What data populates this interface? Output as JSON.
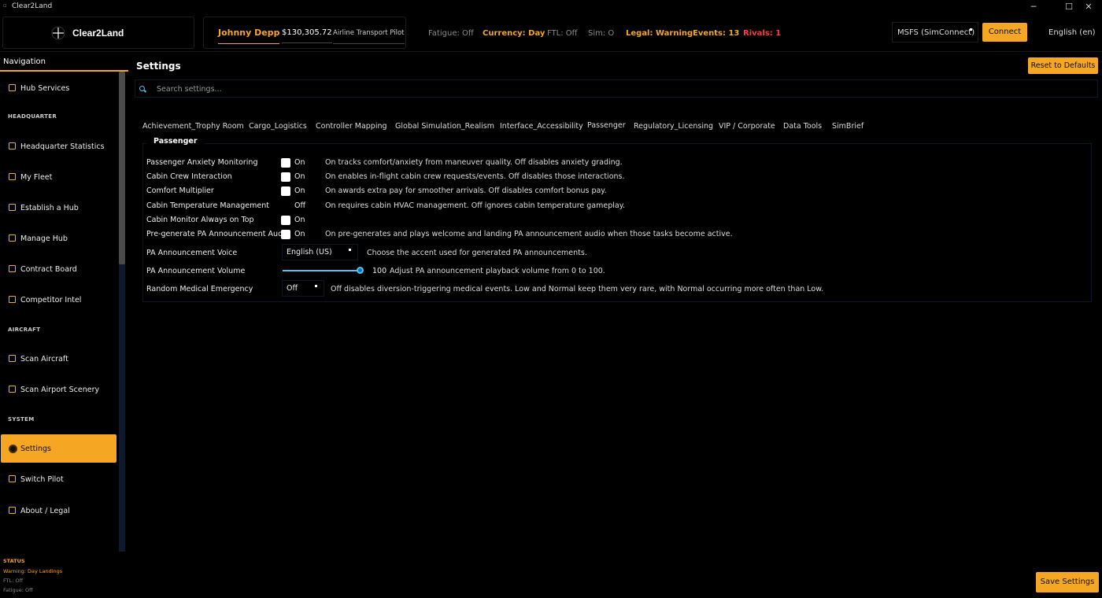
{
  "window": {
    "title": "Clear2Land",
    "minimize": "─",
    "maximize": "☐",
    "close": "✕"
  },
  "topbar": {
    "logo_text": "Clear2Land",
    "pilot_name": "Johnny Depp",
    "balance": "$130,305.72",
    "rank": "Airline Transport Pilot",
    "status": {
      "fatigue": "Fatigue: Off",
      "currency": "Currency: Day",
      "ftl": "FTL: Off",
      "sim": "Sim: O",
      "legal": "Legal: Warning",
      "events": "Events: 13",
      "rivals": "Rivals: 1"
    },
    "sim_select": "MSFS (SimConnect)",
    "connect_label": "Connect",
    "language": "English (en)"
  },
  "sidebar": {
    "header": "Navigation",
    "items": [
      {
        "label": "Hub Services",
        "icon": "building-icon"
      },
      {
        "label": "Headquarter Statistics",
        "icon": "grid-icon"
      },
      {
        "label": "My Fleet",
        "icon": "hangar-icon"
      },
      {
        "label": "Establish a Hub",
        "icon": "building-icon"
      },
      {
        "label": "Manage Hub",
        "icon": "building-icon"
      },
      {
        "label": "Contract Board",
        "icon": "clipboard-icon"
      },
      {
        "label": "Competitor Intel",
        "icon": "grid-icon"
      },
      {
        "label": "Scan Aircraft",
        "icon": "magnifier-icon"
      },
      {
        "label": "Scan Airport Scenery",
        "icon": "map-icon"
      },
      {
        "label": "Settings",
        "icon": "gear-icon"
      },
      {
        "label": "Switch Pilot",
        "icon": "swap-icon"
      },
      {
        "label": "About / Legal",
        "icon": "info-icon"
      }
    ],
    "sections": [
      "HEADQUARTER",
      "AIRCRAFT",
      "SYSTEM"
    ],
    "status": {
      "heading": "STATUS",
      "warning": "Warning: Day Landings",
      "ftl": "FTL: Off",
      "fatigue": "Fatigue: Off"
    }
  },
  "main": {
    "title": "Settings",
    "reset_label": "Reset to Defaults",
    "search_placeholder": "Search settings...",
    "tabs": [
      "Achievement_Trophy Room",
      "Cargo_Logistics",
      "Controller Mapping",
      "Global Simulation_Realism",
      "Interface_Accessibility",
      "Passenger",
      "Regulatory_Licensing",
      "VIP / Corporate",
      "Data Tools",
      "SimBrief"
    ],
    "active_tab": "Passenger",
    "group_title": "Passenger",
    "settings": [
      {
        "label": "Passenger Anxiety Monitoring",
        "checked": true,
        "state": "On",
        "desc": "On tracks comfort/anxiety from maneuver quality. Off disables anxiety grading."
      },
      {
        "label": "Cabin Crew Interaction",
        "checked": true,
        "state": "On",
        "desc": "On enables in-flight cabin crew requests/events. Off disables those interactions."
      },
      {
        "label": "Comfort Multiplier",
        "checked": true,
        "state": "On",
        "desc": "On awards extra pay for smoother arrivals. Off disables comfort bonus pay."
      },
      {
        "label": "Cabin Temperature Management",
        "checked": false,
        "state": "Off",
        "desc": "On requires cabin HVAC management. Off ignores cabin temperature gameplay."
      },
      {
        "label": "Cabin Monitor Always on Top",
        "checked": true,
        "state": "On",
        "desc": ""
      },
      {
        "label": "Pre-generate PA Announcement Audio",
        "checked": true,
        "state": "On",
        "desc": "On pre-generates and plays welcome and landing PA announcement audio when those tasks become active."
      }
    ],
    "voice": {
      "label": "PA Announcement Voice",
      "value": "English (US)",
      "desc": "Choose the accent used for generated PA announcements."
    },
    "volume": {
      "label": "PA Announcement Volume",
      "value": "100",
      "level": 1.0,
      "desc": "Adjust PA announcement playback volume from 0 to 100."
    },
    "medical": {
      "label": "Random Medical Emergency",
      "value": "Off",
      "desc": "Off disables diversion-triggering medical events. Low and Normal keep them very rare, with Normal occurring more often than Low."
    },
    "save_label": "Save Settings"
  },
  "colors": {
    "accent": "#f5a623",
    "info": "#4fc3f7",
    "danger": "#ff3b3b",
    "muted": "#8a8a8a"
  }
}
